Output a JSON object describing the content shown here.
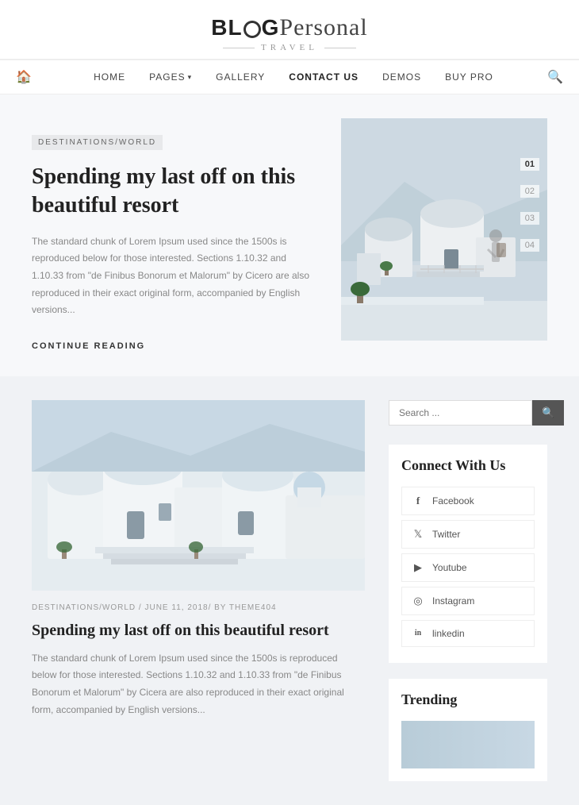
{
  "header": {
    "logo_blog": "BL",
    "logo_o": "O",
    "logo_g": "G",
    "logo_personal": "Personal",
    "logo_subtitle": "TRAVEL"
  },
  "nav": {
    "home_icon": "🏠",
    "items": [
      {
        "label": "HOME",
        "active": false
      },
      {
        "label": "PAGES",
        "active": false,
        "has_dropdown": true
      },
      {
        "label": "GALLERY",
        "active": false
      },
      {
        "label": "CONTACT US",
        "active": true
      },
      {
        "label": "DEMOS",
        "active": false
      },
      {
        "label": "BUY PRO",
        "active": false
      }
    ],
    "search_icon": "🔍"
  },
  "featured": {
    "category": "DESTINATIONS/WORLD",
    "title": "Spending my last off on this beautiful resort",
    "excerpt": "The standard chunk of Lorem Ipsum used since the 1500s is reproduced below for those interested. Sections 1.10.32 and 1.10.33 from \"de Finibus Bonorum et Malorum\" by Cicero are also reproduced in their exact original form, accompanied by English versions...",
    "continue_label": "CONTINUE READING",
    "slide_numbers": [
      "01",
      "02",
      "03",
      "04"
    ]
  },
  "post": {
    "meta": "DESTINATIONS/WORLD / JUNE 11, 2018/ BY THEME404",
    "title": "Spending my last off on this beautiful resort",
    "excerpt": "The standard chunk of Lorem Ipsum used since the 1500s is reproduced below for those interested. Sections 1.10.32 and 1.10.33 from \"de Finibus Bonorum et Malorum\" by Cicera are also reproduced in their exact original form, accompanied by English versions..."
  },
  "sidebar": {
    "search_placeholder": "Search ...",
    "search_icon": "🔍",
    "connect_title": "Connect With Us",
    "social_items": [
      {
        "icon": "f",
        "label": "Facebook"
      },
      {
        "icon": "t",
        "label": "Twitter"
      },
      {
        "icon": "▶",
        "label": "Youtube"
      },
      {
        "icon": "◎",
        "label": "Instagram"
      },
      {
        "icon": "in",
        "label": "linkedin"
      }
    ],
    "trending_title": "Trending"
  }
}
